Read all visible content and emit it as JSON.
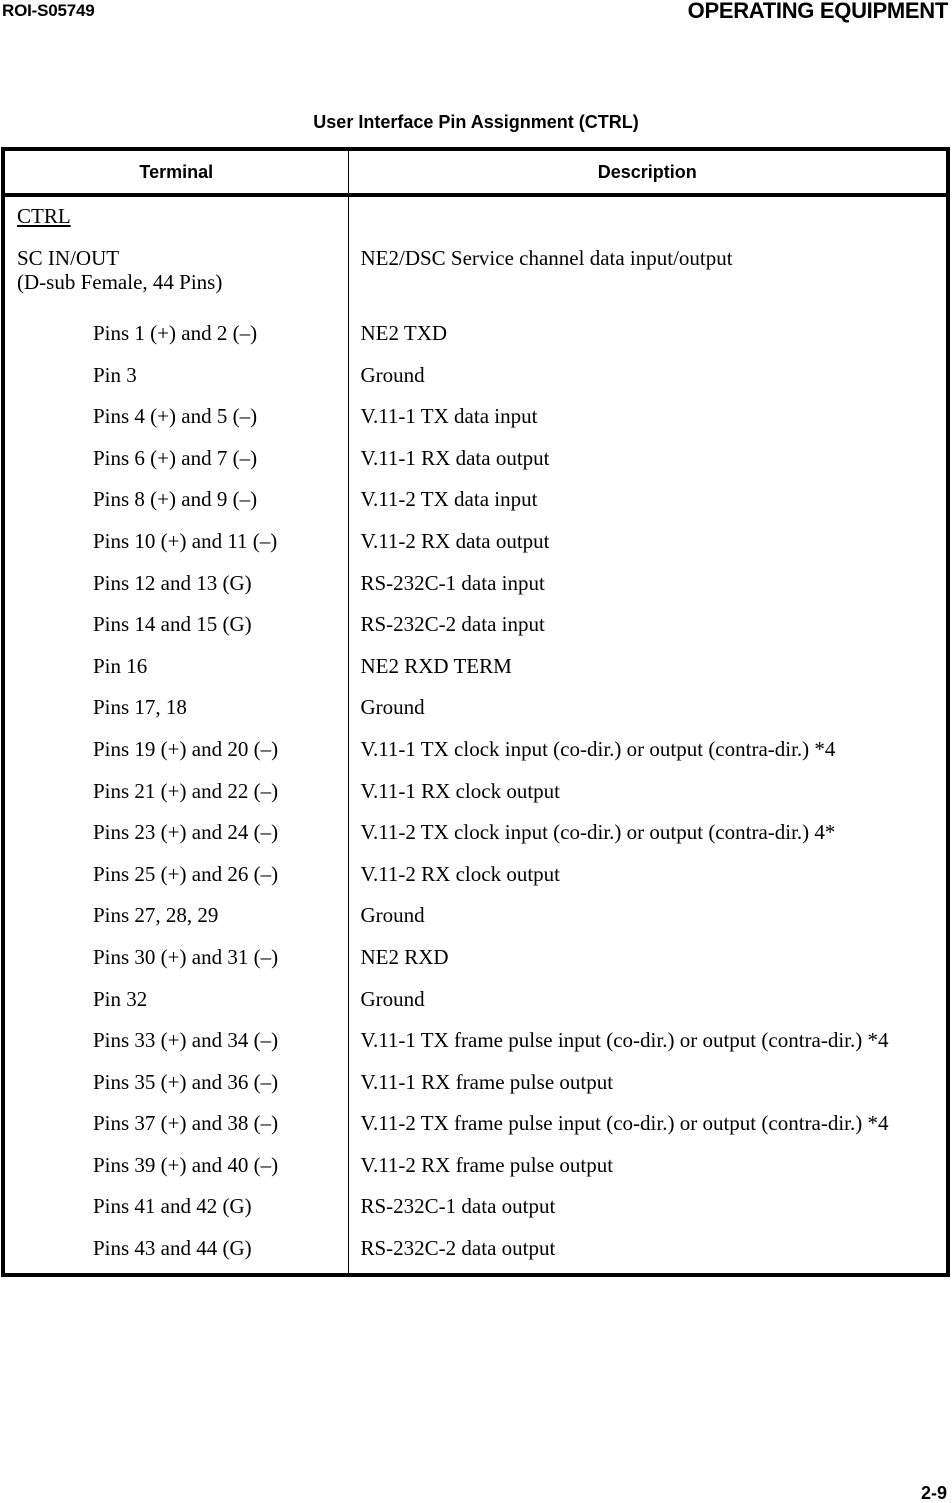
{
  "page_header": {
    "doc_id": "ROI-S05749",
    "section_title": "OPERATING EQUIPMENT"
  },
  "table": {
    "title": "User Interface Pin Assignment (CTRL)",
    "columns": [
      "Terminal",
      "Description"
    ],
    "section_label": "CTRL",
    "connector": {
      "name": "SC IN/OUT",
      "type": "(D-sub Female, 44 Pins)",
      "description": "NE2/DSC Service channel data input/output"
    },
    "rows": [
      {
        "terminal": "Pins 1 (+) and 2 (–)",
        "description": "NE2 TXD"
      },
      {
        "terminal": "Pin 3",
        "description": "Ground"
      },
      {
        "terminal": "Pins 4 (+) and 5 (–)",
        "description": "V.11-1 TX data input"
      },
      {
        "terminal": "Pins 6 (+) and 7 (–)",
        "description": "V.11-1 RX data output"
      },
      {
        "terminal": "Pins 8 (+) and 9 (–)",
        "description": "V.11-2 TX data input"
      },
      {
        "terminal": "Pins 10 (+) and 11 (–)",
        "description": "V.11-2 RX data output"
      },
      {
        "terminal": "Pins 12 and 13 (G)",
        "description": "RS-232C-1 data input"
      },
      {
        "terminal": "Pins 14 and 15 (G)",
        "description": "RS-232C-2 data input"
      },
      {
        "terminal": "Pin 16",
        "description": "NE2 RXD TERM"
      },
      {
        "terminal": "Pins 17, 18",
        "description": "Ground"
      },
      {
        "terminal": "Pins 19 (+) and 20 (–)",
        "description": "V.11-1 TX clock input (co-dir.) or output (contra-dir.) *4"
      },
      {
        "terminal": "Pins 21 (+) and 22 (–)",
        "description": "V.11-1 RX clock output"
      },
      {
        "terminal": "Pins 23 (+) and 24 (–)",
        "description": "V.11-2 TX clock input (co-dir.) or output (contra-dir.) 4*"
      },
      {
        "terminal": "Pins 25 (+) and 26 (–)",
        "description": "V.11-2 RX clock output"
      },
      {
        "terminal": "Pins 27, 28, 29",
        "description": "Ground"
      },
      {
        "terminal": "Pins 30 (+) and 31 (–)",
        "description": "NE2 RXD"
      },
      {
        "terminal": "Pin 32",
        "description": "Ground"
      },
      {
        "terminal": "Pins 33 (+) and 34 (–)",
        "description": "V.11-1 TX frame pulse input (co-dir.) or output (contra-dir.) *4"
      },
      {
        "terminal": "Pins 35 (+) and 36 (–)",
        "description": "V.11-1 RX frame pulse output"
      },
      {
        "terminal": "Pins 37 (+) and 38 (–)",
        "description": "V.11-2 TX frame pulse input (co-dir.) or output (contra-dir.) *4"
      },
      {
        "terminal": "Pins 39 (+) and 40 (–)",
        "description": "V.11-2 RX frame pulse output"
      },
      {
        "terminal": "Pins 41 and 42 (G)",
        "description": "RS-232C-1 data output"
      },
      {
        "terminal": "Pins 43 and 44 (G)",
        "description": "RS-232C-2 data output"
      }
    ]
  },
  "page_footer": {
    "page_number": "2-9"
  }
}
